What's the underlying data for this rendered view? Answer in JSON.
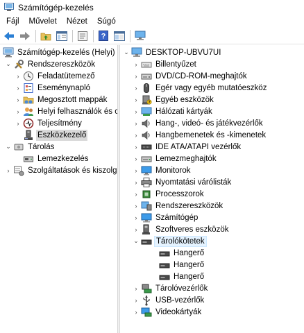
{
  "window": {
    "title": "Számítógép-kezelés"
  },
  "menu": {
    "items": [
      "Fájl",
      "Művelet",
      "Nézet",
      "Súgó"
    ]
  },
  "toolbar": {
    "buttons": [
      "back-icon",
      "forward-icon",
      "up-folder-icon",
      "show-hide-tree-icon",
      "properties-icon",
      "help-icon",
      "console-view-icon",
      "monitor-icon"
    ]
  },
  "left_tree": {
    "root": "Számítógép-kezelés (Helyi)",
    "system_tools": "Rendszereszközök",
    "system_items": [
      "Feladatütemező",
      "Eseménynapló",
      "Megosztott mappák",
      "Helyi felhasználók és cs",
      "Teljesítmény",
      "Eszközkezelő"
    ],
    "storage": "Tárolás",
    "storage_items": [
      "Lemezkezelés"
    ],
    "services": "Szolgáltatások és kiszolgálók"
  },
  "device_tree": {
    "root": "DESKTOP-UBVU7UI",
    "categories": [
      "Billentyűzet",
      "DVD/CD-ROM-meghajtók",
      "Egér vagy egyéb mutatóeszköz",
      "Egyéb eszközök",
      "Hálózati kártyák",
      "Hang-, videó- és játékvezérlők",
      "Hangbemenetek és -kimenetek",
      "IDE ATA/ATAPI vezérlők",
      "Lemezmeghajtók",
      "Monitorok",
      "Nyomtatási várólisták",
      "Processzorok",
      "Rendszereszközök",
      "Számítógép",
      "Szoftveres eszközök",
      "Tárolókötetek"
    ],
    "volumes": [
      "Hangerő",
      "Hangerő",
      "Hangerő"
    ],
    "after_categories": [
      "Tárolóvezérlők",
      "USB-vezérlők",
      "Videokártyák"
    ]
  },
  "colors": {
    "selection": "#d9d9d9",
    "accent": "#0078d7"
  }
}
